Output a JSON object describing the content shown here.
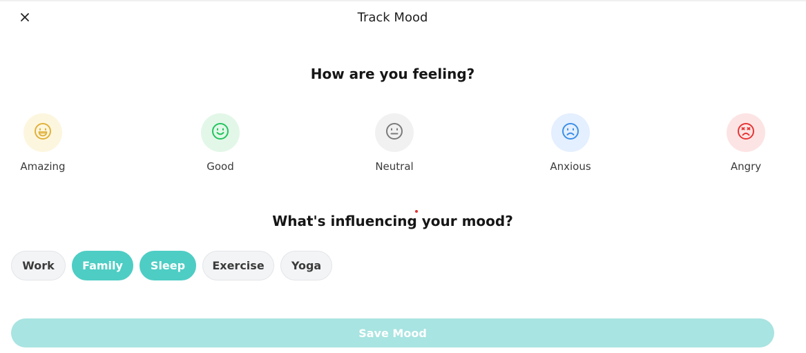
{
  "header": {
    "title": "Track Mood",
    "close_icon": "close-icon"
  },
  "feeling": {
    "question": "How are you feeling?",
    "moods": [
      {
        "label": "Amazing",
        "icon": "grin-face-icon",
        "color": "#e0b13a",
        "bg": "#fdf6df"
      },
      {
        "label": "Good",
        "icon": "smile-face-icon",
        "color": "#22c35e",
        "bg": "#e2f7e8"
      },
      {
        "label": "Neutral",
        "icon": "neutral-face-icon",
        "color": "#7a7a7a",
        "bg": "#f1f1f1"
      },
      {
        "label": "Anxious",
        "icon": "frown-face-icon",
        "color": "#3b8fe6",
        "bg": "#e4efff"
      },
      {
        "label": "Angry",
        "icon": "angry-face-icon",
        "color": "#e53535",
        "bg": "#fde4e4"
      }
    ]
  },
  "influence": {
    "question": "What's influencing your mood?",
    "tags": [
      {
        "label": "Work",
        "selected": false
      },
      {
        "label": "Family",
        "selected": true
      },
      {
        "label": "Sleep",
        "selected": true
      },
      {
        "label": "Exercise",
        "selected": false
      },
      {
        "label": "Yoga",
        "selected": false
      }
    ]
  },
  "save_button": {
    "label": "Save Mood"
  },
  "colors": {
    "accent": "#4ecdc4",
    "accent_disabled": "#a8e4e1",
    "chip_bg": "#f3f4f6"
  }
}
